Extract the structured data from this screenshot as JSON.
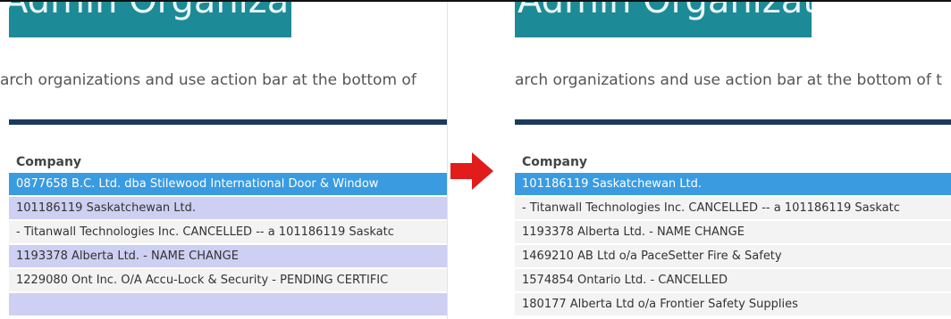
{
  "left": {
    "title": "Admin Organizations",
    "subtitle": "arch organizations and use action bar at the bottom of",
    "column_header": "Company",
    "rows": [
      {
        "label": "0877658 B.C. Ltd. dba Stilewood International Door & Window",
        "state": "selected"
      },
      {
        "label": "101186119 Saskatchewan Ltd.",
        "state": "highlight"
      },
      {
        "label": "- Titanwall Technologies Inc. CANCELLED -- a 101186119 Saskatc",
        "state": "plain"
      },
      {
        "label": "1193378 Alberta Ltd. - NAME CHANGE",
        "state": "highlight"
      },
      {
        "label": "1229080 Ont Inc. O/A Accu-Lock & Security - PENDING CERTIFIC",
        "state": "plain"
      },
      {
        "label": "",
        "state": "highlight"
      }
    ]
  },
  "right": {
    "title": "Admin Organizations",
    "subtitle": "arch organizations and use action bar at the bottom of t",
    "column_header": "Company",
    "rows": [
      {
        "label": "101186119 Saskatchewan Ltd.",
        "state": "selected"
      },
      {
        "label": "- Titanwall Technologies Inc. CANCELLED -- a 101186119 Saskatc",
        "state": "plain"
      },
      {
        "label": "1193378 Alberta Ltd. - NAME CHANGE",
        "state": "plain"
      },
      {
        "label": "1469210 AB Ltd o/a PaceSetter Fire & Safety",
        "state": "plain"
      },
      {
        "label": "1574854 Ontario Ltd. - CANCELLED",
        "state": "plain"
      },
      {
        "label": "180177 Alberta Ltd o/a Frontier Safety Supplies",
        "state": "plain"
      }
    ]
  },
  "arrow_icon": "arrow-right-icon",
  "colors": {
    "title_bar": "#1d8a97",
    "dark_rule": "#1c3a5e",
    "selected_row": "#3a9be0",
    "highlight_row": "#cdd0f2",
    "plain_row": "#f3f3f3",
    "arrow": "#e21b1b"
  }
}
